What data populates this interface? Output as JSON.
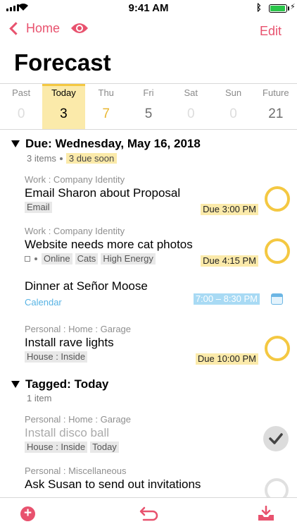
{
  "status": {
    "time": "9:41 AM",
    "battery_level": 0.95,
    "battery_color": "#2ac64a"
  },
  "nav": {
    "back_label": "Home",
    "edit_label": "Edit",
    "accent": "#e8526e"
  },
  "page_title": "Forecast",
  "days": [
    {
      "name": "Past",
      "count": "0"
    },
    {
      "name": "Today",
      "count": "3"
    },
    {
      "name": "Thu",
      "count": "7"
    },
    {
      "name": "Fri",
      "count": "5"
    },
    {
      "name": "Sat",
      "count": "0"
    },
    {
      "name": "Sun",
      "count": "0"
    },
    {
      "name": "Future",
      "count": "21"
    }
  ],
  "due_section": {
    "title": "Due: Wednesday, May 16, 2018",
    "count": "3 items",
    "soon": "3 due soon",
    "items": [
      {
        "crumb": "Work : Company Identity",
        "title": "Email Sharon about Proposal",
        "tags": [
          "Email"
        ],
        "due": "Due 3:00 PM"
      },
      {
        "crumb": "Work : Company Identity",
        "title": "Website needs more cat photos",
        "tags": [
          "Online",
          "Cats",
          "High Energy"
        ],
        "due": "Due 4:15 PM"
      },
      {
        "title": "Dinner at Señor Moose",
        "calendar_label": "Calendar",
        "time": "7:00 – 8:30 PM"
      },
      {
        "crumb": "Personal : Home : Garage",
        "title": "Install rave lights",
        "tags": [
          "House : Inside"
        ],
        "due": "Due 10:00 PM"
      }
    ]
  },
  "tagged_section": {
    "title": "Tagged: Today",
    "count": "1 item",
    "items": [
      {
        "crumb": "Personal : Home : Garage",
        "title": "Install disco ball",
        "tags": [
          "House : Inside",
          "Today"
        ],
        "completed": true
      },
      {
        "crumb": "Personal : Miscellaneous",
        "title": "Ask Susan to send out invitations"
      }
    ]
  },
  "colors": {
    "due_yellow": "#fbeaaa",
    "ring_yellow": "#f4c842",
    "calendar_blue": "#a8daf4"
  },
  "icons": [
    "eye-icon",
    "add-icon",
    "undo-icon",
    "inbox-icon",
    "checkmark-icon",
    "calendar-icon"
  ]
}
